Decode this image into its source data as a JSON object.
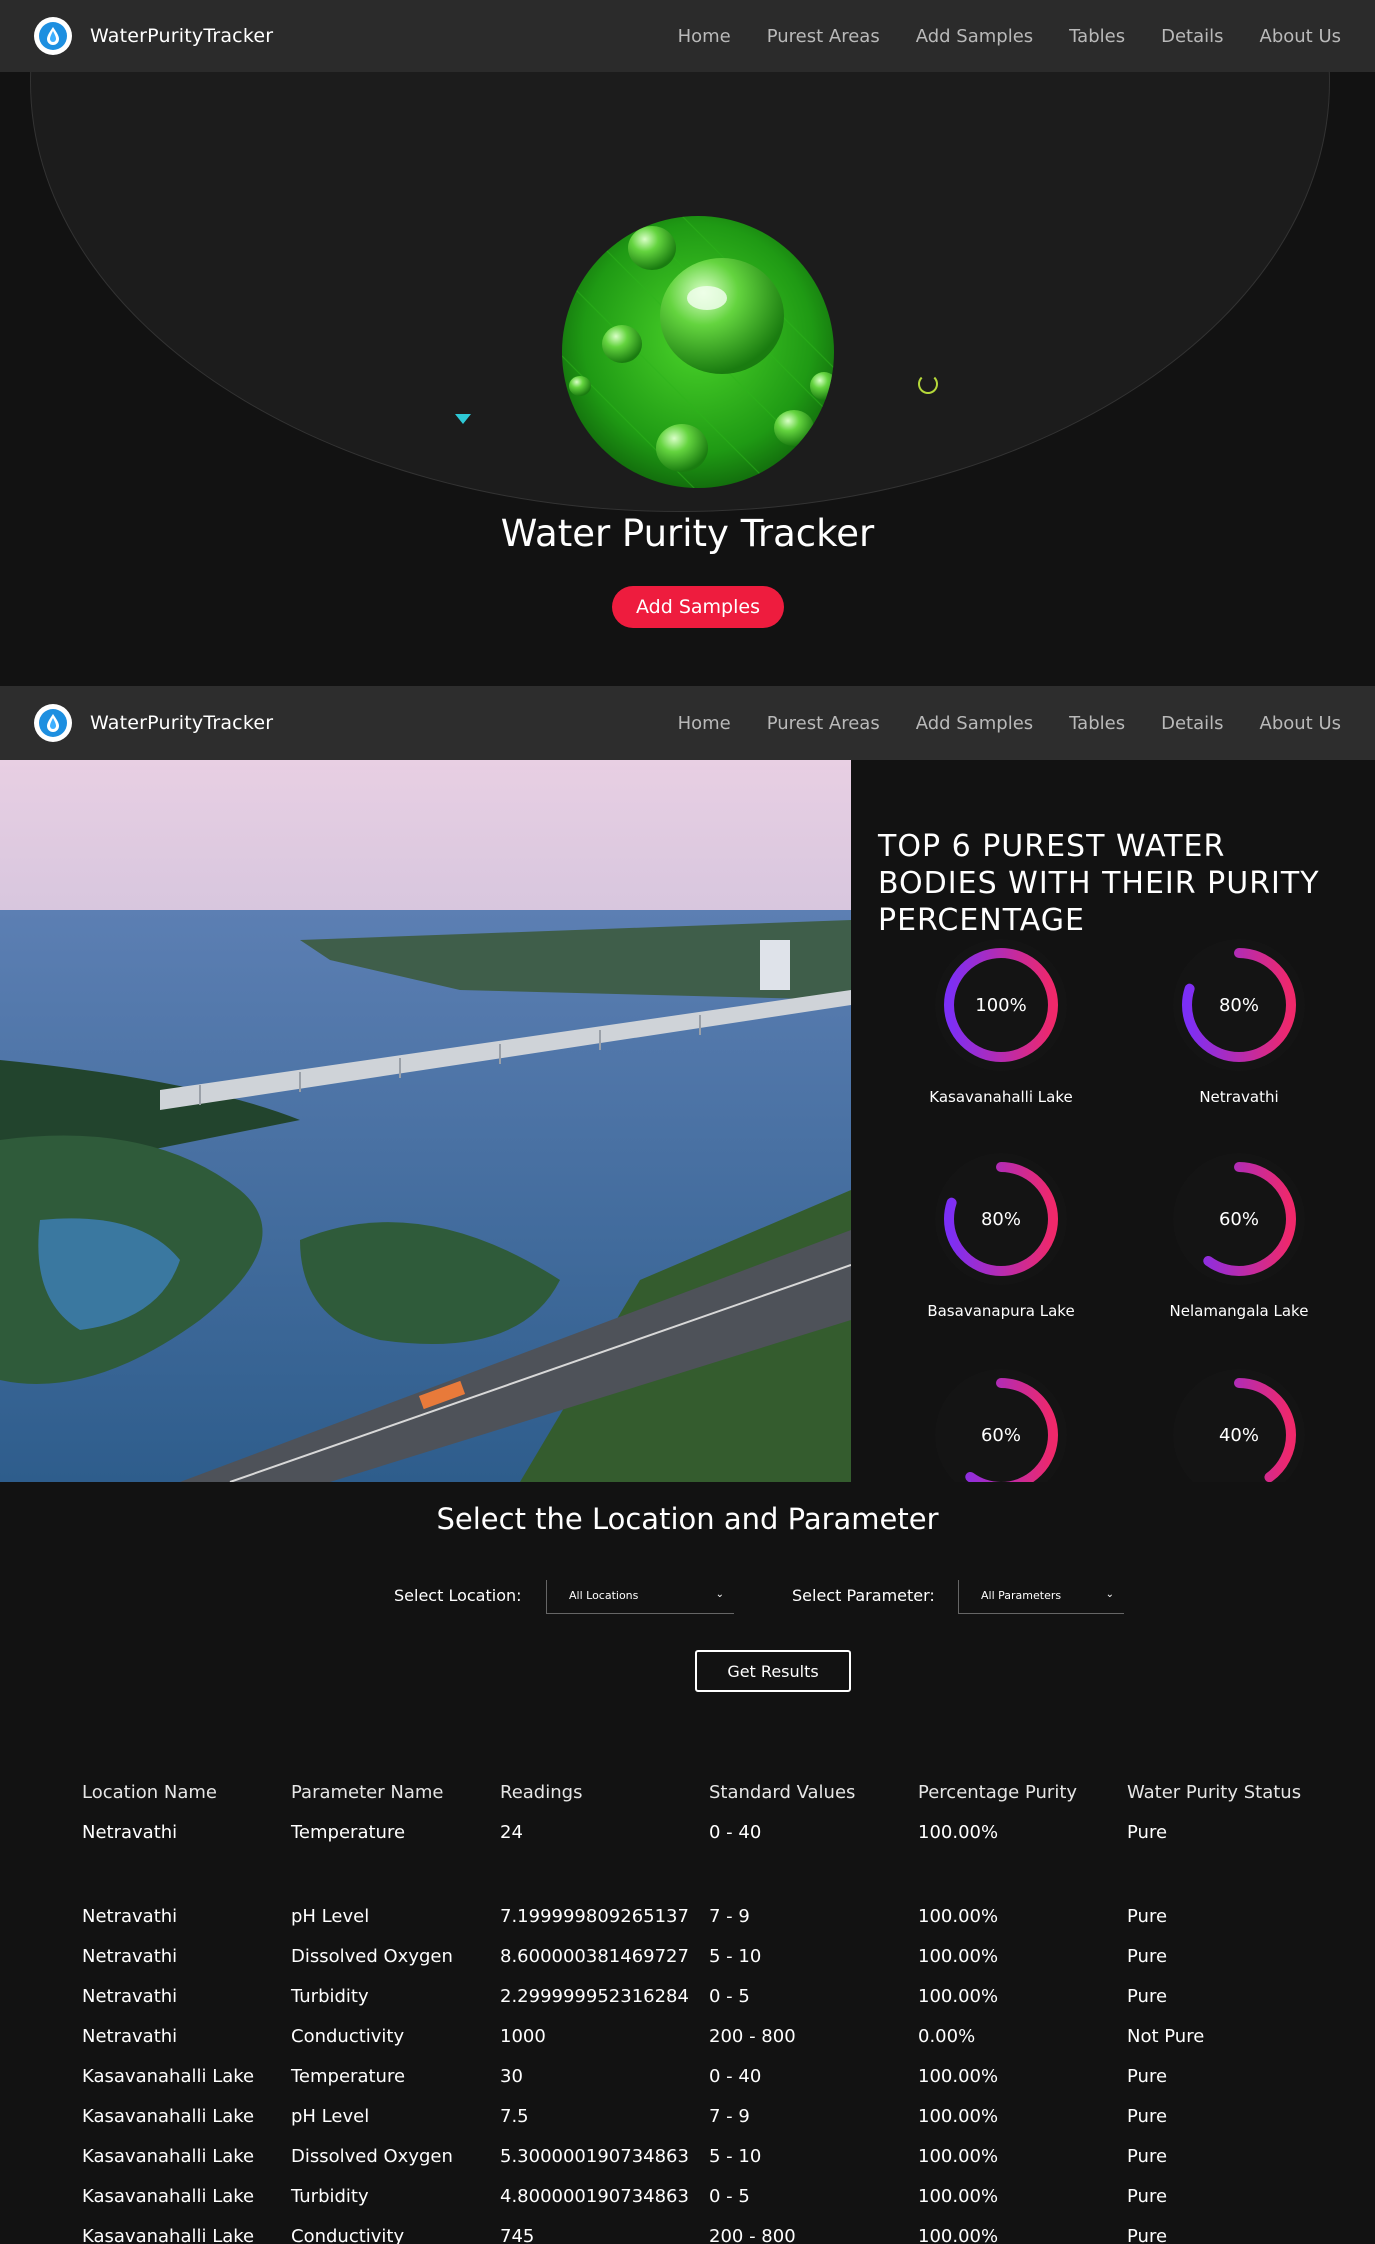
{
  "app": {
    "brand": "WaterPurityTracker"
  },
  "nav": {
    "links": [
      "Home",
      "Purest Areas",
      "Add Samples",
      "Tables",
      "Details",
      "About Us"
    ]
  },
  "hero": {
    "title": "Water Purity Tracker",
    "button": "Add Samples"
  },
  "purest": {
    "title": "TOP 6 PUREST WATER BODIES WITH THEIR PURITY PERCENTAGE",
    "items": [
      {
        "label": "100%",
        "value": 100,
        "name": "Kasavanahalli Lake"
      },
      {
        "label": "80%",
        "value": 80,
        "name": "Netravathi"
      },
      {
        "label": "80%",
        "value": 80,
        "name": "Basavanapura Lake"
      },
      {
        "label": "60%",
        "value": 60,
        "name": "Nelamangala Lake"
      },
      {
        "label": "60%",
        "value": 60,
        "name": ""
      },
      {
        "label": "40%",
        "value": 40,
        "name": ""
      }
    ],
    "gauge_colors": {
      "start": "#7b2ff7",
      "end": "#f0286a"
    }
  },
  "select": {
    "title": "Select the Location and Parameter",
    "location_label": "Select Location:",
    "location_value": "All Locations",
    "parameter_label": "Select Parameter:",
    "parameter_value": "All Parameters",
    "button": "Get Results"
  },
  "table": {
    "headers": [
      "Location Name",
      "Parameter Name",
      "Readings",
      "Standard Values",
      "Percentage Purity",
      "Water Purity Status"
    ],
    "rows": [
      [
        "Netravathi",
        "Temperature",
        "24",
        "0 - 40",
        "100.00%",
        "Pure"
      ],
      [
        "Netravathi",
        "pH Level",
        "7.199999809265137",
        "7 - 9",
        "100.00%",
        "Pure"
      ],
      [
        "Netravathi",
        "Dissolved Oxygen",
        "8.600000381469727",
        "5 - 10",
        "100.00%",
        "Pure"
      ],
      [
        "Netravathi",
        "Turbidity",
        "2.299999952316284",
        "0 - 5",
        "100.00%",
        "Pure"
      ],
      [
        "Netravathi",
        "Conductivity",
        "1000",
        "200 - 800",
        "0.00%",
        "Not Pure"
      ],
      [
        "Kasavanahalli Lake",
        "Temperature",
        "30",
        "0 - 40",
        "100.00%",
        "Pure"
      ],
      [
        "Kasavanahalli Lake",
        "pH Level",
        "7.5",
        "7 - 9",
        "100.00%",
        "Pure"
      ],
      [
        "Kasavanahalli Lake",
        "Dissolved Oxygen",
        "5.300000190734863",
        "5 - 10",
        "100.00%",
        "Pure"
      ],
      [
        "Kasavanahalli Lake",
        "Turbidity",
        "4.800000190734863",
        "0 - 5",
        "100.00%",
        "Pure"
      ],
      [
        "Kasavanahalli Lake",
        "Conductivity",
        "745",
        "200 - 800",
        "100.00%",
        "Pure"
      ]
    ]
  }
}
